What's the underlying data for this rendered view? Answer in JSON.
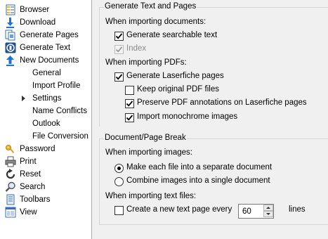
{
  "sidebar": {
    "items": [
      {
        "label": "Browser",
        "icon": "browser-icon"
      },
      {
        "label": "Download",
        "icon": "download-icon"
      },
      {
        "label": "Generate Pages",
        "icon": "generate-pages-icon"
      },
      {
        "label": "Generate Text",
        "icon": "generate-text-icon"
      },
      {
        "label": "New Documents",
        "icon": "new-documents-icon"
      },
      {
        "label": "General"
      },
      {
        "label": "Import Profile"
      },
      {
        "label": "Settings",
        "selected": true
      },
      {
        "label": "Name Conflicts"
      },
      {
        "label": "Outlook"
      },
      {
        "label": "File Conversion"
      },
      {
        "label": "Password",
        "icon": "key-icon"
      },
      {
        "label": "Print",
        "icon": "printer-icon"
      },
      {
        "label": "Reset",
        "icon": "reset-icon"
      },
      {
        "label": "Search",
        "icon": "search-icon"
      },
      {
        "label": "Toolbars",
        "icon": "toolbars-icon"
      },
      {
        "label": "View",
        "icon": "view-icon"
      }
    ]
  },
  "generate_text_pages": {
    "title": "Generate Text and Pages",
    "importing_documents_label": "When importing documents:",
    "generate_searchable_text": {
      "label": "Generate searchable text",
      "checked": true
    },
    "index": {
      "label": "Index",
      "checked": true,
      "disabled": true
    },
    "importing_pdfs_label": "When importing PDFs:",
    "generate_laserfiche_pages": {
      "label": "Generate Laserfiche pages",
      "checked": true
    },
    "keep_original_pdf": {
      "label": "Keep original PDF files",
      "checked": false
    },
    "preserve_pdf_annotations": {
      "label": "Preserve PDF annotations on Laserfiche pages",
      "checked": true
    },
    "import_monochrome": {
      "label": "Import monochrome images",
      "checked": true
    }
  },
  "document_page_break": {
    "title": "Document/Page Break",
    "importing_images_label": "When importing images:",
    "radio_separate": {
      "label": "Make each file into a separate document",
      "selected": true
    },
    "radio_single": {
      "label": "Combine images into a single document",
      "selected": false
    },
    "importing_text_label": "When importing text files:",
    "create_new_text_page": {
      "label": "Create a new text page every",
      "checked": false
    },
    "lines_value": "60",
    "lines_label": "lines"
  },
  "colors": {
    "sidebar_bg": "#ffffff",
    "panel_bg": "#f0f0f0",
    "group_line": "#d5d5d5"
  }
}
